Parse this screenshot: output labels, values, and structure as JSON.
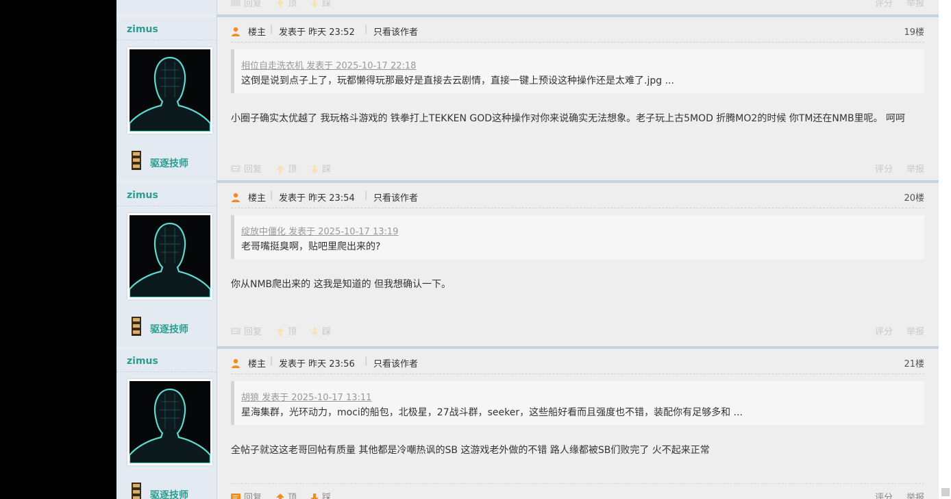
{
  "prev_actions": {
    "reply": "回复",
    "up": "顶",
    "down": "踩",
    "rate": "评分",
    "report": "举报"
  },
  "posts": [
    {
      "author": "zimus",
      "badge": "驱逐技师",
      "lz": "楼主",
      "posted": "发表于 昨天 23:52",
      "only_author": "只看该作者",
      "floor": "19楼",
      "quote_head": "相位自走洗衣机 发表于 2025-10-17 22:18",
      "quote_text": "这倒是说到点子上了，玩都懒得玩那最好是直接去云剧情，直接一键上预设这种操作还是太难了.jpg ...",
      "body": "小圈子确实太优越了 我玩格斗游戏的 铁拳打上TEKKEN GOD这种操作对你来说确实无法想象。老子玩上古5MOD 折腾MO2的时候 你TM还在NMB里呢。  呵呵",
      "actions": {
        "reply": "回复",
        "up": "顶",
        "down": "踩",
        "rate": "评分",
        "report": "举报"
      }
    },
    {
      "author": "zimus",
      "badge": "驱逐技师",
      "lz": "楼主",
      "posted": "发表于 昨天 23:54",
      "only_author": "只看该作者",
      "floor": "20楼",
      "quote_head": "绽放中僵化 发表于 2025-10-17 13:19",
      "quote_text": "老哥嘴挺臭啊，贴吧里爬出来的?",
      "body": "你从NMB爬出来的 这我是知道的 但我想确认一下。",
      "actions": {
        "reply": "回复",
        "up": "顶",
        "down": "踩",
        "rate": "评分",
        "report": "举报"
      }
    },
    {
      "author": "zimus",
      "badge": "驱逐技师",
      "lz": "楼主",
      "posted": "发表于 昨天 23:56",
      "only_author": "只看该作者",
      "floor": "21楼",
      "quote_head": "胡狼 发表于 2025-10-17 13:11",
      "quote_text": "星海集群，光环动力，moci的船包，北极星，27战斗群，seeker，这些船好看而且强度也不错，装配你有足够多和 ...",
      "body": "全帖子就这这老哥回帖有质量  其他都是冷嘲热讽的SB 这游戏老外做的不错 路人缘都被SB们败完了 火不起来正常",
      "actions": {
        "reply": "回复",
        "up": "顶",
        "down": "踩",
        "rate": "评分",
        "report": "举报"
      }
    }
  ],
  "colors": {
    "username": "#2a9d8f",
    "accent_orange": "#f28c1e"
  },
  "icons": [
    "user-icon",
    "reply-icon",
    "thumb-up-icon",
    "thumb-down-icon",
    "avatar-silhouette",
    "badge-icon"
  ]
}
